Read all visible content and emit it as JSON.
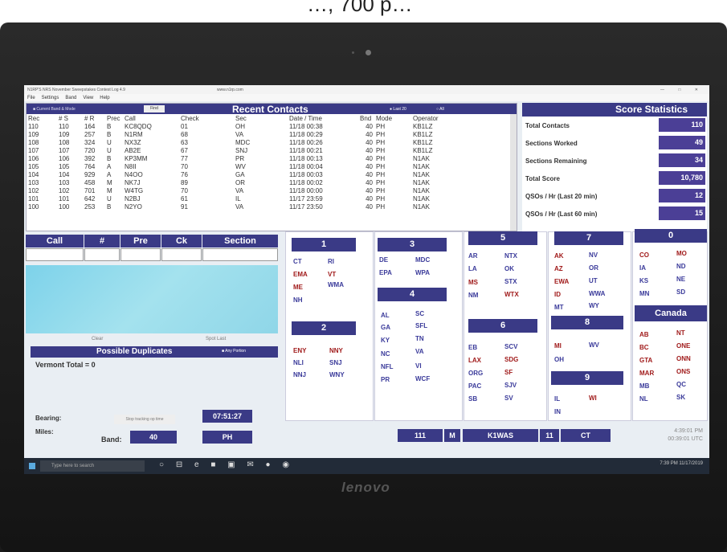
{
  "app": {
    "title": "N1RP'S NRS November Sweepstakes Contest Log 4.9",
    "url": "www.n1rp.com",
    "window_controls": "—  □  ✕",
    "menu": [
      "File",
      "Settings",
      "Band",
      "View",
      "Help"
    ]
  },
  "recent": {
    "current_band_label": "Current Band & Mode",
    "find_label": "Find",
    "title": "Recent Contacts",
    "radio_last20": "Last 20",
    "radio_all": "All",
    "columns": [
      "Rec",
      "# S",
      "# R",
      "Prec",
      "Call",
      "Check",
      "Sec",
      "Date  /  Time",
      "Bnd",
      "Mode",
      "Operator"
    ],
    "rows": [
      [
        "110",
        "110",
        "164",
        "B",
        "KC8QDQ",
        "01",
        "OH",
        "11/18 00:38",
        "40",
        "PH",
        "KB1LZ"
      ],
      [
        "109",
        "109",
        "257",
        "B",
        "N1RM",
        "68",
        "VA",
        "11/18 00:29",
        "40",
        "PH",
        "KB1LZ"
      ],
      [
        "108",
        "108",
        "324",
        "U",
        "NX3Z",
        "63",
        "MDC",
        "11/18 00:26",
        "40",
        "PH",
        "KB1LZ"
      ],
      [
        "107",
        "107",
        "720",
        "U",
        "AB2E",
        "67",
        "SNJ",
        "11/18 00:21",
        "40",
        "PH",
        "KB1LZ"
      ],
      [
        "106",
        "106",
        "392",
        "B",
        "KP3MM",
        "77",
        "PR",
        "11/18 00:13",
        "40",
        "PH",
        "N1AK"
      ],
      [
        "105",
        "105",
        "764",
        "A",
        "N8II",
        "70",
        "WV",
        "11/18 00:04",
        "40",
        "PH",
        "N1AK"
      ],
      [
        "104",
        "104",
        "929",
        "A",
        "N4OO",
        "76",
        "GA",
        "11/18 00:03",
        "40",
        "PH",
        "N1AK"
      ],
      [
        "103",
        "103",
        "458",
        "M",
        "NK7J",
        "89",
        "OR",
        "11/18 00:02",
        "40",
        "PH",
        "N1AK"
      ],
      [
        "102",
        "102",
        "701",
        "M",
        "W4TG",
        "70",
        "VA",
        "11/18 00:00",
        "40",
        "PH",
        "N1AK"
      ],
      [
        "101",
        "101",
        "642",
        "U",
        "N2BJ",
        "61",
        "IL",
        "11/17 23:59",
        "40",
        "PH",
        "N1AK"
      ],
      [
        "100",
        "100",
        "253",
        "B",
        "N2YO",
        "91",
        "VA",
        "11/17 23:50",
        "40",
        "PH",
        "N1AK"
      ]
    ]
  },
  "score": {
    "title": "Score Statistics",
    "rows": [
      {
        "label": "Total Contacts",
        "value": "110"
      },
      {
        "label": "Sections Worked",
        "value": "49"
      },
      {
        "label": "Sections Remaining",
        "value": "34"
      },
      {
        "label": "Total Score",
        "value": "10,780"
      },
      {
        "label": "QSOs / Hr (Last 20 min)",
        "value": "12"
      },
      {
        "label": "QSOs / Hr (Last 60 min)",
        "value": "15"
      }
    ]
  },
  "entry": {
    "headers": [
      "Call",
      "#",
      "Pre",
      "Ck",
      "Section"
    ],
    "clear_label": "Clear",
    "spot_last_label": "Spot Last"
  },
  "duplicates": {
    "title": "Possible Duplicates",
    "any_portion_label": "Any Portion",
    "state_text": "Vermont  Total = 0"
  },
  "footer": {
    "bearing_label": "Bearing:",
    "miles_label": "Miles:",
    "stop_tracking_label": "Stop tracking op time",
    "op_time": "07:51:27",
    "band_label": "Band:",
    "band_value": "40",
    "mode_value": "PH",
    "serial": "111",
    "precedence": "M",
    "callsign": "K1WAS",
    "check": "11",
    "section": "CT",
    "local_time": "4:39:01  PM",
    "utc_time": "00:39:01  UTC"
  },
  "areas": {
    "d1": "1",
    "d2": "2",
    "d3": "3",
    "d4": "4",
    "d5": "5",
    "d6": "6",
    "d7": "7",
    "d8": "8",
    "d9": "9",
    "d0": "0",
    "canada": "Canada"
  },
  "taskbar": {
    "search_placeholder": "Type here to search",
    "tray_time": "7:39 PM",
    "tray_date": "11/17/2019"
  },
  "photo": {
    "laptop_brand": "lenovo",
    "cut_text": "…, 700 p…"
  },
  "colors": {
    "header_blue": "#3a3a86",
    "value_purple": "#4b3f96",
    "worked_red": "#a01a1a",
    "needed_blue": "#3a3a9a",
    "entry_cyan": "#8fd6e8"
  }
}
